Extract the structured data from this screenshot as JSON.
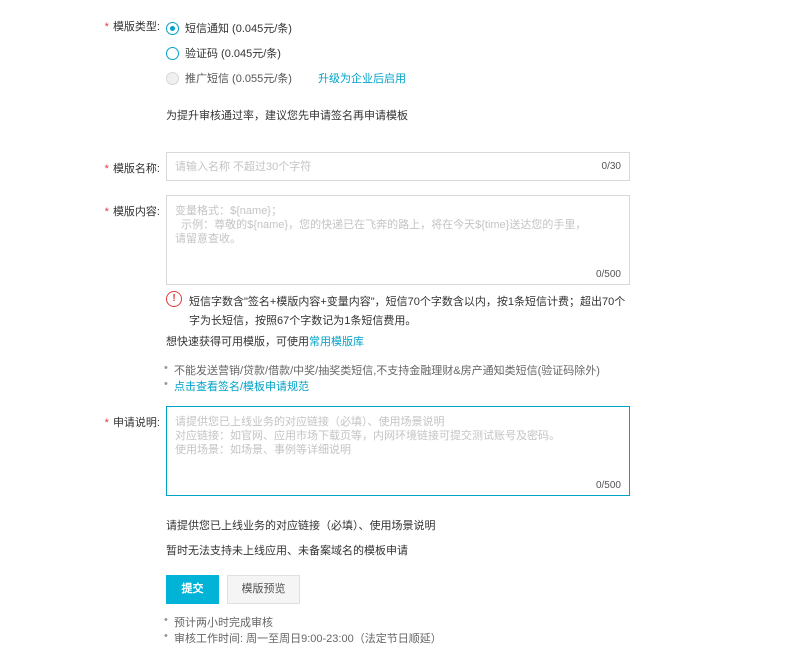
{
  "template_type": {
    "label": "模版类型:",
    "options": [
      {
        "label": "短信通知 (0.045元/条)",
        "state": "checked"
      },
      {
        "label": "验证码 (0.045元/条)",
        "state": "unchecked"
      },
      {
        "label": "推广短信 (0.055元/条)",
        "state": "disabled"
      }
    ],
    "upgrade_link": "升级为企业后启用",
    "hint": "为提升审核通过率，建议您先申请签名再申请模板"
  },
  "template_name": {
    "label": "模版名称:",
    "placeholder": "请输入名称 不超过30个字符",
    "counter": "0/30"
  },
  "template_content": {
    "label": "模版内容:",
    "placeholder_lines": [
      "变量格式：${name}；",
      "  示例：尊敬的${name}，您的快递已在飞奔的路上，将在今天${time}送达您的手里，",
      "请留意查收。"
    ],
    "counter": "0/500",
    "warning_line1": "短信字数含\"签名+模版内容+变量内容\"，短信70个字数含以内，按1条短信计费；超出70个",
    "warning_line2": "字为长短信，按照67个字数记为1条短信费用。",
    "quick_prefix": "想快速获得可用模版，可使用",
    "quick_link": "常用模版库",
    "rules": [
      {
        "text": "不能发送营销/贷款/借款/中奖/抽奖类短信,不支持金融理财&房产通知类短信(验证码除外)",
        "link": false
      },
      {
        "text": "点击查看签名/模板申请规范",
        "link": true
      }
    ]
  },
  "application": {
    "label": "申请说明:",
    "placeholder_lines": [
      "请提供您已上线业务的对应链接（必填）、使用场景说明",
      "对应链接：如官网、应用市场下载页等，内网环境链接可提交测试账号及密码。",
      "使用场景：如场景、事例等详细说明"
    ],
    "counter": "0/500",
    "hint1": "请提供您已上线业务的对应链接（必填）、使用场景说明",
    "hint2": "暂时无法支持未上线应用、未备案域名的模板申请"
  },
  "buttons": {
    "submit": "提交",
    "preview": "模版预览"
  },
  "footer_notes": [
    "预计两小时完成审核",
    "审核工作时间: 周一至周日9:00-23:00（法定节日顺延）"
  ]
}
